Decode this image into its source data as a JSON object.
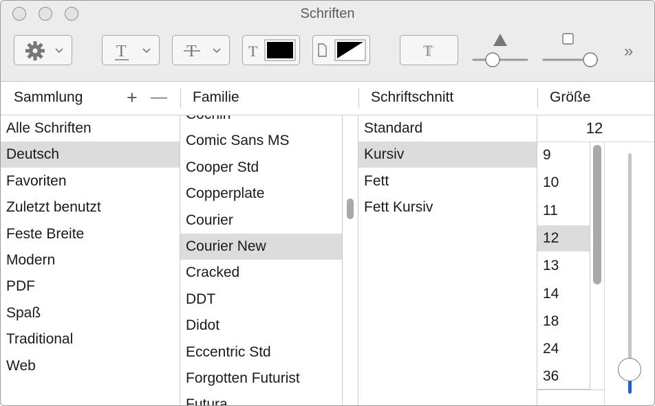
{
  "window": {
    "title": "Schriften"
  },
  "toolbar": {
    "more_label": "»"
  },
  "header": {
    "collection": "Sammlung",
    "family": "Familie",
    "typeface": "Schriftschnitt",
    "size": "Größe",
    "add_label": "+",
    "remove_label": "—"
  },
  "collections": [
    "Alle Schriften",
    "Deutsch",
    "Favoriten",
    "Zuletzt benutzt",
    "Feste Breite",
    "Modern",
    "PDF",
    "Spaß",
    "Traditional",
    "Web"
  ],
  "collections_selected": "Deutsch",
  "families": [
    "Cochin",
    "Comic Sans MS",
    "Cooper Std",
    "Copperplate",
    "Courier",
    "Courier New",
    "Cracked",
    "DDT",
    "Didot",
    "Eccentric Std",
    "Forgotten Futurist",
    "Futura"
  ],
  "families_selected": "Courier New",
  "typefaces": [
    "Standard",
    "Kursiv",
    "Fett",
    "Fett Kursiv"
  ],
  "typefaces_selected": "Kursiv",
  "size": {
    "value": "12",
    "options": [
      "9",
      "10",
      "11",
      "12",
      "13",
      "14",
      "18",
      "24",
      "36"
    ],
    "selected": "12",
    "slider_fraction": 0.1
  }
}
